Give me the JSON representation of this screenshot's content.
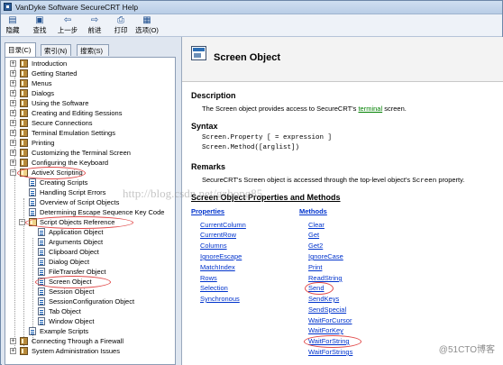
{
  "window": {
    "title": "VanDyke Software SecureCRT Help"
  },
  "toolbar": {
    "buttons": [
      {
        "label": "隐藏",
        "icon": "hide-icon"
      },
      {
        "label": "查找",
        "icon": "find-icon"
      },
      {
        "label": "上一步",
        "icon": "back-icon"
      },
      {
        "label": "前进",
        "icon": "forward-icon"
      },
      {
        "label": "打印",
        "icon": "print-icon"
      },
      {
        "label": "选项(O)",
        "icon": "options-icon"
      }
    ]
  },
  "left_tabs": [
    {
      "label": "目录(C)"
    },
    {
      "label": "索引(N)"
    },
    {
      "label": "搜索(S)"
    }
  ],
  "tree": [
    {
      "label": "Introduction"
    },
    {
      "label": "Getting Started"
    },
    {
      "label": "Menus"
    },
    {
      "label": "Dialogs"
    },
    {
      "label": "Using the Software"
    },
    {
      "label": "Creating and Editing Sessions"
    },
    {
      "label": "Secure Connections"
    },
    {
      "label": "Terminal Emulation Settings"
    },
    {
      "label": "Printing"
    },
    {
      "label": "Customizing the Terminal Screen"
    },
    {
      "label": "Configuring the Keyboard"
    },
    {
      "label": "ActiveX Scripting"
    },
    {
      "label": "Creating Scripts"
    },
    {
      "label": "Handling Script Errors"
    },
    {
      "label": "Overview of Script Objects"
    },
    {
      "label": "Determining Escape Sequence Key Code"
    },
    {
      "label": "Script Objects Reference"
    },
    {
      "label": "Application Object"
    },
    {
      "label": "Arguments Object"
    },
    {
      "label": "Clipboard Object"
    },
    {
      "label": "Dialog Object"
    },
    {
      "label": "FileTransfer Object"
    },
    {
      "label": "Screen Object"
    },
    {
      "label": "Session Object"
    },
    {
      "label": "SessionConfiguration Object"
    },
    {
      "label": "Tab Object"
    },
    {
      "label": "Window Object"
    },
    {
      "label": "Example Scripts"
    },
    {
      "label": "Connecting Through a Firewall"
    },
    {
      "label": "System Administration Issues"
    }
  ],
  "content": {
    "title": "Screen Object",
    "description_heading": "Description",
    "description_before": "The Screen object provides access to SecureCRT's ",
    "description_link": "terminal",
    "description_after": " screen.",
    "syntax_heading": "Syntax",
    "syntax_line1": "Screen.Property [ = expression ]",
    "syntax_line2": "Screen.Method([arglist])",
    "remarks_heading": "Remarks",
    "remarks_before": "SecureCRT's Screen object is accessed through the top-level object's ",
    "remarks_code": "Screen",
    "remarks_after": " property.",
    "section_heading": "Screen Object Properties and Methods",
    "properties_heading": "Properties",
    "methods_heading": "Methods",
    "properties": [
      "CurrentColumn",
      "CurrentRow",
      "Columns",
      "IgnoreEscape",
      "MatchIndex",
      "Rows",
      "Selection",
      "Synchronous"
    ],
    "methods": [
      "Clear",
      "Get",
      "Get2",
      "IgnoreCase",
      "Print",
      "ReadString",
      "Send",
      "SendKeys",
      "SendSpecial",
      "WaitForCursor",
      "WaitForKey",
      "WaitForString",
      "WaitForStrings"
    ]
  },
  "watermark": {
    "text": "http://blog.csdn.net/gzhong85"
  },
  "corner_mark": {
    "text": "@51CTO博客"
  },
  "colors": {
    "highlight_oval": "#e14a4a",
    "link": "#0033cc",
    "inline_link": "#008000"
  }
}
